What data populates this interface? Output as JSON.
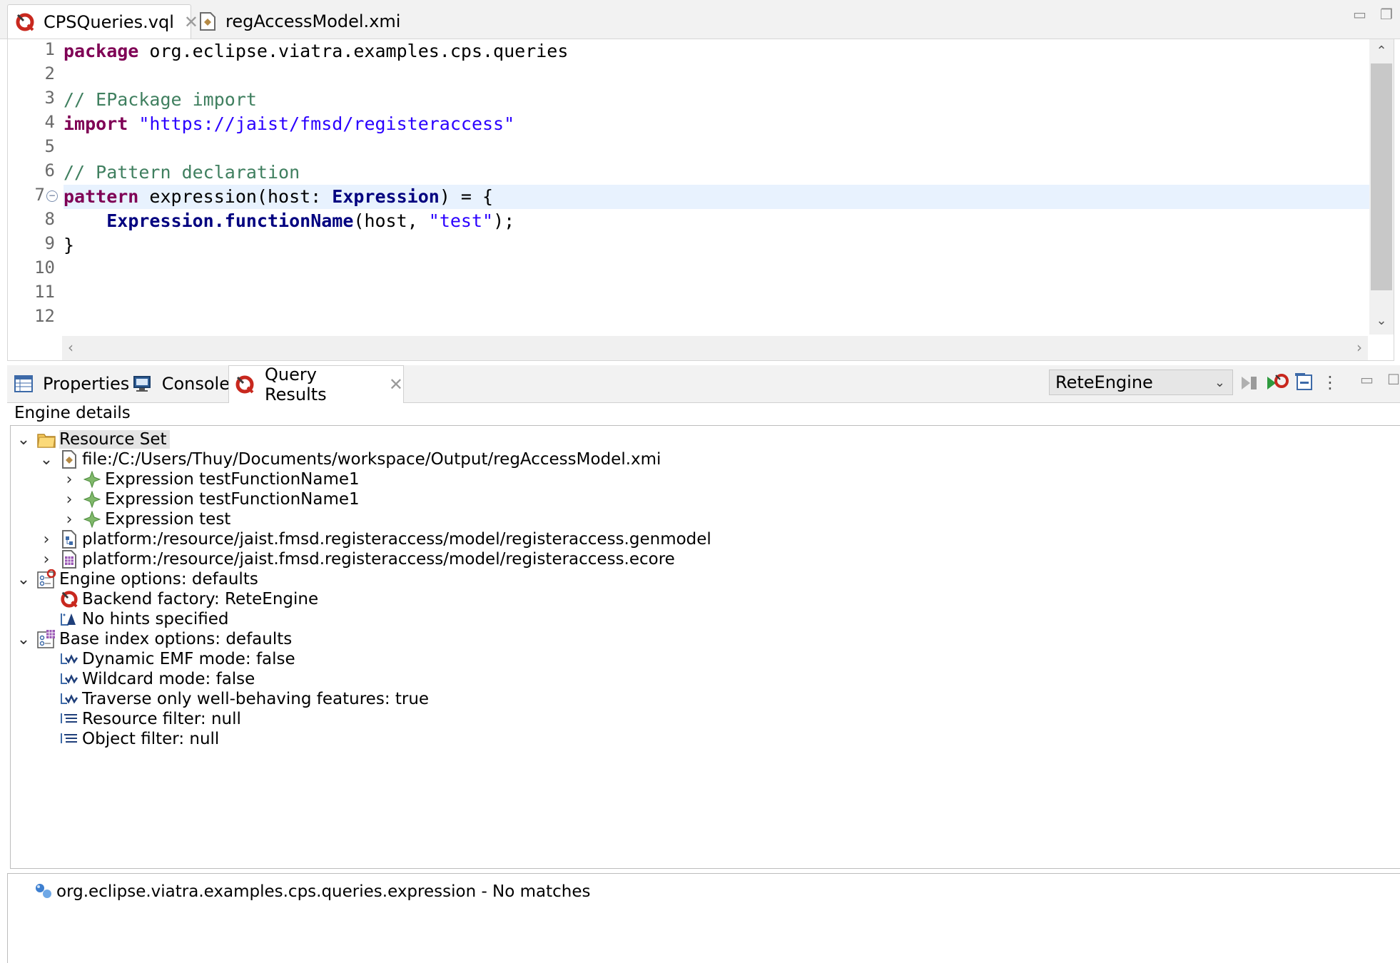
{
  "editor_tabs": [
    {
      "label": "CPSQueries.vql",
      "icon": "viatra-query-icon",
      "active": true,
      "closable": true
    },
    {
      "label": "regAccessModel.xmi",
      "icon": "xmi-model-icon",
      "active": false,
      "closable": false
    }
  ],
  "editor": {
    "line_numbers": [
      "1",
      "2",
      "3",
      "4",
      "5",
      "6",
      "7",
      "8",
      "9",
      "10",
      "11",
      "12"
    ],
    "code": {
      "l1_kw": "package",
      "l1_rest": " org.eclipse.viatra.examples.cps.queries",
      "l3_comment": "// EPackage import",
      "l4_kw": "import",
      "l4_str": " \"https://jaist/fmsd/registeraccess\"",
      "l6_comment": "// Pattern declaration",
      "l7_kw": "pattern",
      "l7_a": " expression(host: ",
      "l7_type": "Expression",
      "l7_b": ") = {",
      "l8_indent": "    ",
      "l8_type": "Expression.functionName",
      "l8_a": "(host, ",
      "l8_str": "\"test\"",
      "l8_b": ");",
      "l9": "}"
    }
  },
  "view_tabs": [
    {
      "label": "Properties",
      "icon": "properties-table-icon",
      "active": false
    },
    {
      "label": "Console",
      "icon": "console-monitor-icon",
      "active": false
    },
    {
      "label": "Query Results",
      "icon": "viatra-query-icon",
      "active": true,
      "closable": true
    }
  ],
  "engine_select": {
    "value": "ReteEngine"
  },
  "engine_details_label": "Engine details",
  "tree": {
    "resource_set": "Resource Set",
    "xmi_file": "file:/C:/Users/Thuy/Documents/workspace/Output/regAccessModel.xmi",
    "expr1": "Expression testFunctionName1",
    "expr2": "Expression testFunctionName1",
    "expr3": "Expression test",
    "genmodel": "platform:/resource/jaist.fmsd.registeraccess/model/registeraccess.genmodel",
    "ecore": "platform:/resource/jaist.fmsd.registeraccess/model/registeraccess.ecore",
    "engine_options": "Engine options: defaults",
    "backend_factory": "Backend factory: ReteEngine",
    "no_hints": "No hints specified",
    "base_index": "Base index options: defaults",
    "dynamic_emf": "Dynamic EMF mode: false",
    "wildcard": "Wildcard mode: false",
    "traverse": "Traverse only well-behaving features: true",
    "resource_filter": "Resource filter: null",
    "object_filter": "Object filter: null"
  },
  "results": {
    "query": "org.eclipse.viatra.examples.cps.queries.expression - No matches"
  },
  "colors": {
    "keyword": "#7f0055",
    "comment": "#3f7f5f",
    "string": "#2a00ff",
    "type": "#00007f",
    "current_line": "#e8f2fe",
    "viatra_red": "#c8281e"
  }
}
